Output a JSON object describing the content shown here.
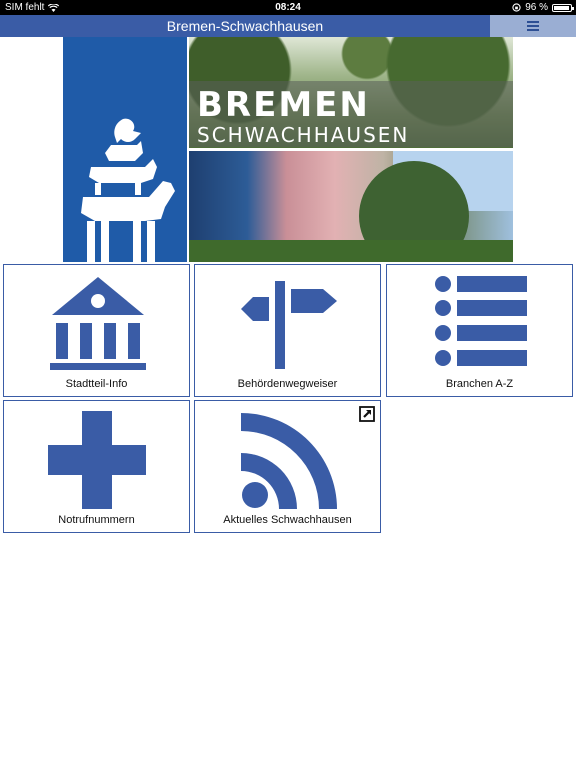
{
  "status_bar": {
    "carrier": "SIM fehlt",
    "time": "08:24",
    "battery_percent": "96 %",
    "battery_level": 0.96
  },
  "nav": {
    "title": "Bremen-Schwachhausen"
  },
  "banner": {
    "line1": "BREMEN",
    "line2": "SCHWACHHAUSEN"
  },
  "tiles": [
    {
      "label": "Stadtteil-Info",
      "icon": "bank-building-icon"
    },
    {
      "label": "Behördenwegweiser",
      "icon": "signpost-icon"
    },
    {
      "label": "Branchen A-Z",
      "icon": "list-icon"
    },
    {
      "label": "Notrufnummern",
      "icon": "cross-icon"
    },
    {
      "label": "Aktuelles Schwachhausen",
      "icon": "rss-feed-icon"
    }
  ],
  "colors": {
    "brand_blue": "#3a5ca6",
    "icon_blue": "#3a5ca6",
    "menu_button_bg": "#9aaed3"
  }
}
